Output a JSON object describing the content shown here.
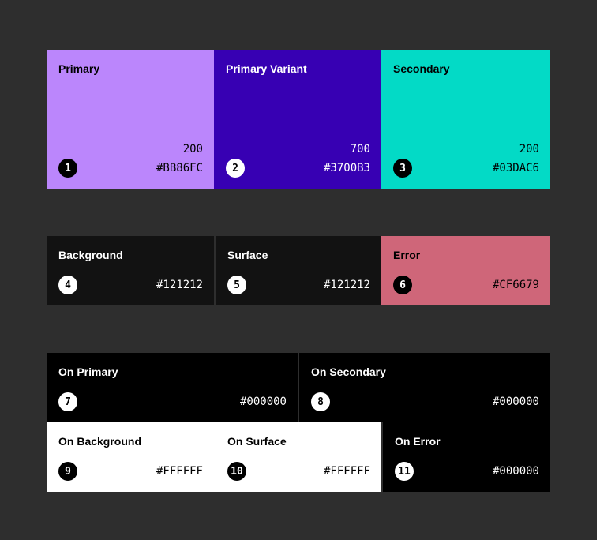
{
  "row1": [
    {
      "name": "Primary",
      "tone": "200",
      "hex": "#BB86FC",
      "number": "1",
      "color": "#BB86FC"
    },
    {
      "name": "Primary Variant",
      "tone": "700",
      "hex": "#3700B3",
      "number": "2",
      "color": "#3700B3"
    },
    {
      "name": "Secondary",
      "tone": "200",
      "hex": "#03DAC6",
      "number": "3",
      "color": "#03DAC6"
    }
  ],
  "row2": [
    {
      "name": "Background",
      "hex": "#121212",
      "number": "4",
      "color": "#121212"
    },
    {
      "name": "Surface",
      "hex": "#121212",
      "number": "5",
      "color": "#121212"
    },
    {
      "name": "Error",
      "hex": "#CF6679",
      "number": "6",
      "color": "#CF6679"
    }
  ],
  "row3": [
    {
      "name": "On Primary",
      "hex": "#000000",
      "number": "7",
      "color": "#000000"
    },
    {
      "name": "On Secondary",
      "hex": "#000000",
      "number": "8",
      "color": "#000000"
    }
  ],
  "row4": [
    {
      "name": "On Background",
      "hex": "#FFFFFF",
      "number": "9",
      "color": "#FFFFFF"
    },
    {
      "name": "On Surface",
      "hex": "#FFFFFF",
      "number": "10",
      "color": "#FFFFFF"
    },
    {
      "name": "On Error",
      "hex": "#000000",
      "number": "11",
      "color": "#000000"
    }
  ]
}
